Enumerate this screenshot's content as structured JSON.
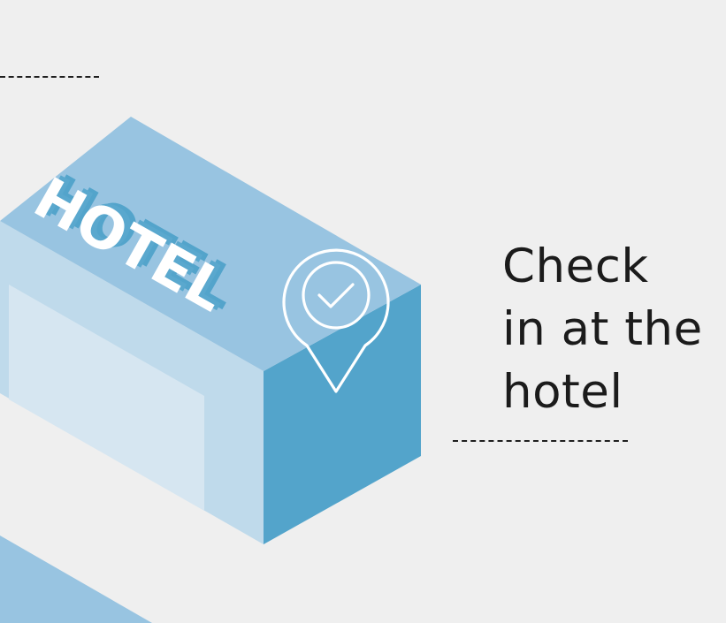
{
  "caption": {
    "line1": "Check",
    "line2": "in at the",
    "line3": "hotel"
  },
  "sign": {
    "text": "HOTEL"
  },
  "icons": {
    "pin": "location-pin-check-icon"
  },
  "colors": {
    "background": "#efefef",
    "roof": "#98c4e1",
    "side_right": "#53a4cb",
    "side_left": "#bfdaeb",
    "window": "#d6e6f1",
    "sign_letters": "#ffffff",
    "sign_shadow": "#53a4cb",
    "text": "#1b1b1b"
  }
}
